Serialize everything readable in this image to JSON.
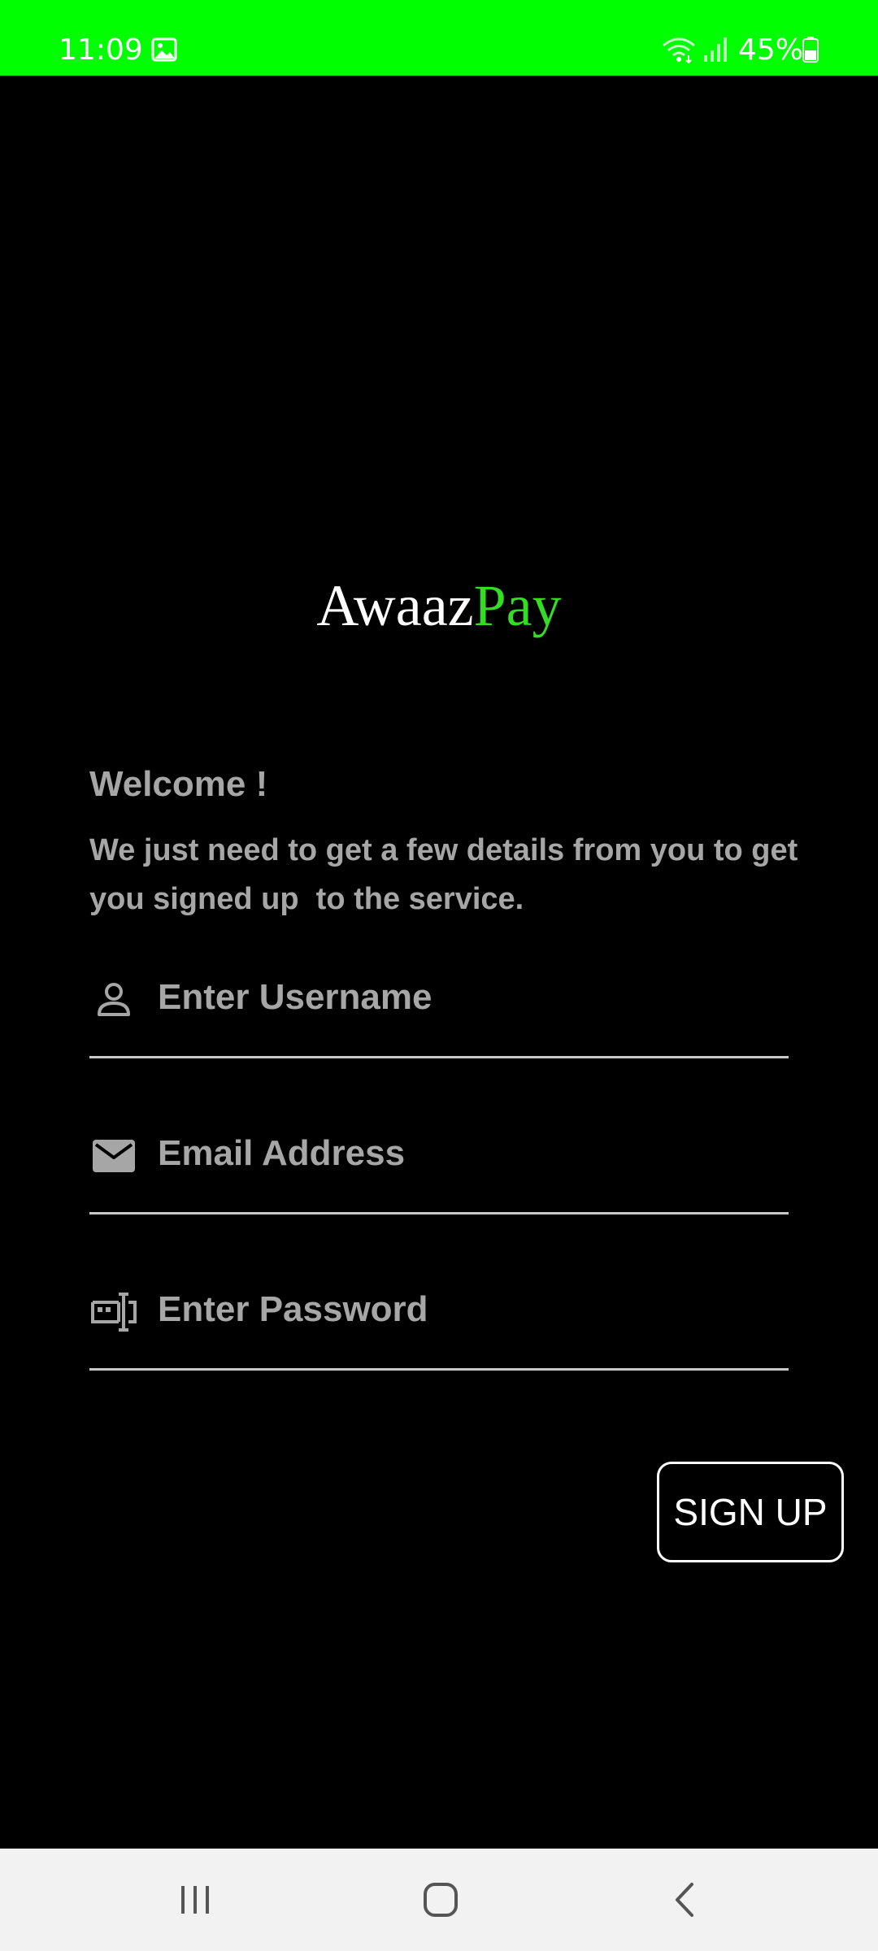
{
  "status_bar": {
    "time": "11:09",
    "battery_percent": "45%",
    "background_color": "#00ff00",
    "icons": [
      "gallery-icon",
      "wifi-icon",
      "signal-icon",
      "battery-icon"
    ]
  },
  "logo": {
    "part1": "Awaaz",
    "part2": "Pay",
    "part1_color": "#ffffff",
    "part2_color": "#33dd22"
  },
  "welcome": {
    "title": "Welcome !",
    "subtitle": "We just need to get a few details from you to get you signed up  to the service."
  },
  "form": {
    "username": {
      "placeholder": "Enter Username",
      "value": "",
      "icon": "person-icon"
    },
    "email": {
      "placeholder": "Email Address",
      "value": "",
      "icon": "mail-icon"
    },
    "password": {
      "placeholder": "Enter Password",
      "value": "",
      "icon": "password-icon"
    },
    "signup_label": "SIGN UP"
  },
  "nav_bar": {
    "buttons": [
      "recents-icon",
      "home-icon",
      "back-icon"
    ]
  }
}
